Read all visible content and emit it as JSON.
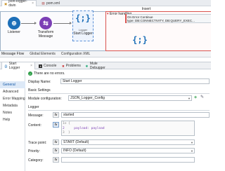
{
  "file_tabs": [
    {
      "label": "json-logger-dwin",
      "active": true
    },
    {
      "label": "pom.xml",
      "active": false
    }
  ],
  "flow": {
    "nodes": {
      "listener": {
        "label": "Listener",
        "color": "#1d6fb8"
      },
      "transform": {
        "label": "Transform Message",
        "color": "#7b3fb5"
      },
      "logger": {
        "label": "Start Logger",
        "badge": "Logger",
        "braces": "{;}"
      }
    },
    "error_handling": {
      "title": "Error handling",
      "on_error_label": "On Error Continue",
      "on_error_type": "type: DB:CONNECTIVITY, DB:QUERY_EXEC...",
      "insert_label": "Insert",
      "logger_braces": "{;}"
    }
  },
  "view_tabs": [
    "Message Flow",
    "Global Elements",
    "Configuration XML"
  ],
  "panel_tabs": [
    {
      "label": "Start Logger",
      "active": true,
      "close": "×"
    },
    {
      "label": "Console",
      "active": false
    },
    {
      "label": "Problems",
      "active": false
    },
    {
      "label": "Mule Debugger",
      "active": false
    }
  ],
  "side_nav": [
    "General",
    "Advanced",
    "Error Mapping",
    "Metadata",
    "Notes",
    "Help"
  ],
  "form": {
    "no_errors": "There are no errors.",
    "display_name_label": "Display Name:",
    "display_name_value": "Start Logger",
    "basic_settings_title": "Basic Settings",
    "module_config_label": "Module configuration:",
    "module_config_value": "JSON_Logger_Config",
    "logger_title": "Logger",
    "message_label": "Message:",
    "message_value": "started",
    "content_label": "Content:",
    "content_lines": [
      "1⊖ {",
      "2     payload: payload",
      "3  }"
    ],
    "trace_point_label": "Trace point:",
    "trace_point_value": "START (Default)",
    "priority_label": "Priority:",
    "priority_value": "INFO (Default)",
    "category_label": "Category:",
    "category_value": "",
    "fx": "fx"
  },
  "colors": {
    "accent": "#1d6fb8",
    "error": "#d9534f",
    "selection": "#5a8fd6"
  }
}
